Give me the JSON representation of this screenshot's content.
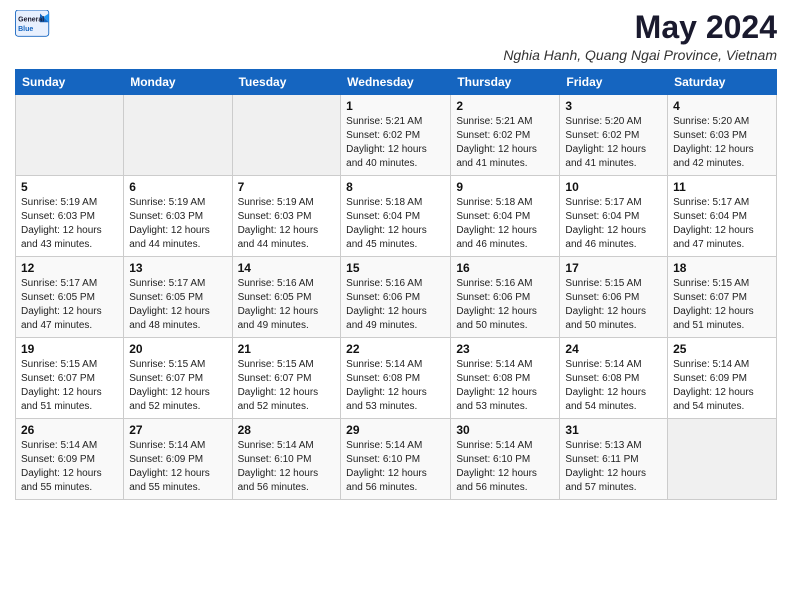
{
  "logo": {
    "line1": "General",
    "line2": "Blue"
  },
  "title": "May 2024",
  "subtitle": "Nghia Hanh, Quang Ngai Province, Vietnam",
  "days_of_week": [
    "Sunday",
    "Monday",
    "Tuesday",
    "Wednesday",
    "Thursday",
    "Friday",
    "Saturday"
  ],
  "weeks": [
    [
      {
        "day": "",
        "sunrise": "",
        "sunset": "",
        "daylight": ""
      },
      {
        "day": "",
        "sunrise": "",
        "sunset": "",
        "daylight": ""
      },
      {
        "day": "",
        "sunrise": "",
        "sunset": "",
        "daylight": ""
      },
      {
        "day": "1",
        "sunrise": "5:21 AM",
        "sunset": "6:02 PM",
        "daylight": "12 hours and 40 minutes."
      },
      {
        "day": "2",
        "sunrise": "5:21 AM",
        "sunset": "6:02 PM",
        "daylight": "12 hours and 41 minutes."
      },
      {
        "day": "3",
        "sunrise": "5:20 AM",
        "sunset": "6:02 PM",
        "daylight": "12 hours and 41 minutes."
      },
      {
        "day": "4",
        "sunrise": "5:20 AM",
        "sunset": "6:03 PM",
        "daylight": "12 hours and 42 minutes."
      }
    ],
    [
      {
        "day": "5",
        "sunrise": "5:19 AM",
        "sunset": "6:03 PM",
        "daylight": "12 hours and 43 minutes."
      },
      {
        "day": "6",
        "sunrise": "5:19 AM",
        "sunset": "6:03 PM",
        "daylight": "12 hours and 44 minutes."
      },
      {
        "day": "7",
        "sunrise": "5:19 AM",
        "sunset": "6:03 PM",
        "daylight": "12 hours and 44 minutes."
      },
      {
        "day": "8",
        "sunrise": "5:18 AM",
        "sunset": "6:04 PM",
        "daylight": "12 hours and 45 minutes."
      },
      {
        "day": "9",
        "sunrise": "5:18 AM",
        "sunset": "6:04 PM",
        "daylight": "12 hours and 46 minutes."
      },
      {
        "day": "10",
        "sunrise": "5:17 AM",
        "sunset": "6:04 PM",
        "daylight": "12 hours and 46 minutes."
      },
      {
        "day": "11",
        "sunrise": "5:17 AM",
        "sunset": "6:04 PM",
        "daylight": "12 hours and 47 minutes."
      }
    ],
    [
      {
        "day": "12",
        "sunrise": "5:17 AM",
        "sunset": "6:05 PM",
        "daylight": "12 hours and 47 minutes."
      },
      {
        "day": "13",
        "sunrise": "5:17 AM",
        "sunset": "6:05 PM",
        "daylight": "12 hours and 48 minutes."
      },
      {
        "day": "14",
        "sunrise": "5:16 AM",
        "sunset": "6:05 PM",
        "daylight": "12 hours and 49 minutes."
      },
      {
        "day": "15",
        "sunrise": "5:16 AM",
        "sunset": "6:06 PM",
        "daylight": "12 hours and 49 minutes."
      },
      {
        "day": "16",
        "sunrise": "5:16 AM",
        "sunset": "6:06 PM",
        "daylight": "12 hours and 50 minutes."
      },
      {
        "day": "17",
        "sunrise": "5:15 AM",
        "sunset": "6:06 PM",
        "daylight": "12 hours and 50 minutes."
      },
      {
        "day": "18",
        "sunrise": "5:15 AM",
        "sunset": "6:07 PM",
        "daylight": "12 hours and 51 minutes."
      }
    ],
    [
      {
        "day": "19",
        "sunrise": "5:15 AM",
        "sunset": "6:07 PM",
        "daylight": "12 hours and 51 minutes."
      },
      {
        "day": "20",
        "sunrise": "5:15 AM",
        "sunset": "6:07 PM",
        "daylight": "12 hours and 52 minutes."
      },
      {
        "day": "21",
        "sunrise": "5:15 AM",
        "sunset": "6:07 PM",
        "daylight": "12 hours and 52 minutes."
      },
      {
        "day": "22",
        "sunrise": "5:14 AM",
        "sunset": "6:08 PM",
        "daylight": "12 hours and 53 minutes."
      },
      {
        "day": "23",
        "sunrise": "5:14 AM",
        "sunset": "6:08 PM",
        "daylight": "12 hours and 53 minutes."
      },
      {
        "day": "24",
        "sunrise": "5:14 AM",
        "sunset": "6:08 PM",
        "daylight": "12 hours and 54 minutes."
      },
      {
        "day": "25",
        "sunrise": "5:14 AM",
        "sunset": "6:09 PM",
        "daylight": "12 hours and 54 minutes."
      }
    ],
    [
      {
        "day": "26",
        "sunrise": "5:14 AM",
        "sunset": "6:09 PM",
        "daylight": "12 hours and 55 minutes."
      },
      {
        "day": "27",
        "sunrise": "5:14 AM",
        "sunset": "6:09 PM",
        "daylight": "12 hours and 55 minutes."
      },
      {
        "day": "28",
        "sunrise": "5:14 AM",
        "sunset": "6:10 PM",
        "daylight": "12 hours and 56 minutes."
      },
      {
        "day": "29",
        "sunrise": "5:14 AM",
        "sunset": "6:10 PM",
        "daylight": "12 hours and 56 minutes."
      },
      {
        "day": "30",
        "sunrise": "5:14 AM",
        "sunset": "6:10 PM",
        "daylight": "12 hours and 56 minutes."
      },
      {
        "day": "31",
        "sunrise": "5:13 AM",
        "sunset": "6:11 PM",
        "daylight": "12 hours and 57 minutes."
      },
      {
        "day": "",
        "sunrise": "",
        "sunset": "",
        "daylight": ""
      }
    ]
  ]
}
